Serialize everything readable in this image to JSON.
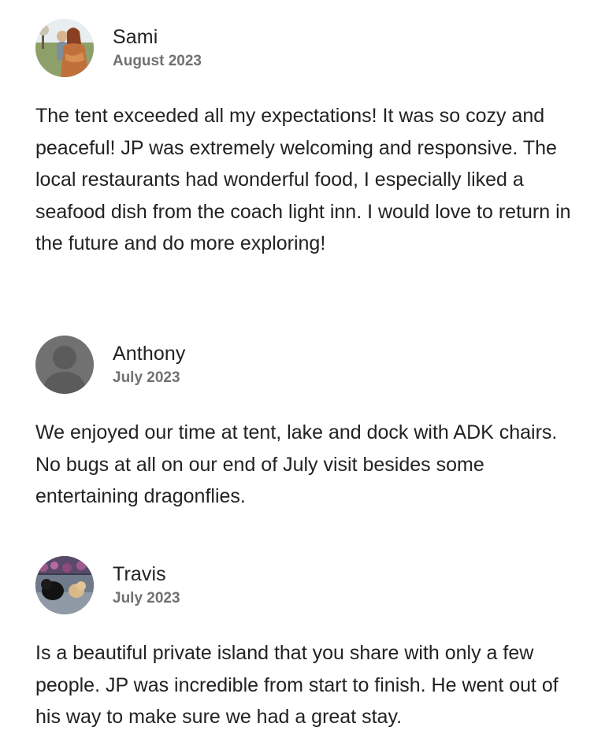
{
  "reviews": [
    {
      "name": "Sami",
      "date": "August 2023",
      "text": "The tent exceeded all my expectations! It was so cozy and peaceful! JP was extremely welcoming and responsive. The local restaurants had wonderful food, I especially liked a seafood dish from the coach light inn. I would love to return in the future and do more exploring!",
      "avatar": "photo-avatar"
    },
    {
      "name": "Anthony",
      "date": "July 2023",
      "text": "We enjoyed our time at tent, lake and dock with ADK chairs. No bugs at all on our end of July visit besides some entertaining dragonflies.",
      "avatar": "default-user-avatar"
    },
    {
      "name": "Travis",
      "date": "July 2023",
      "text": "Is a beautiful private island that you share with only a few people. JP was incredible from start to finish. He went out of his way to make sure we had a great stay.",
      "avatar": "photo-avatar"
    }
  ],
  "colors": {
    "text": "#222222",
    "muted": "#717171",
    "default_avatar_bg": "#717171",
    "default_avatar_fg": "#5b5b5b"
  }
}
